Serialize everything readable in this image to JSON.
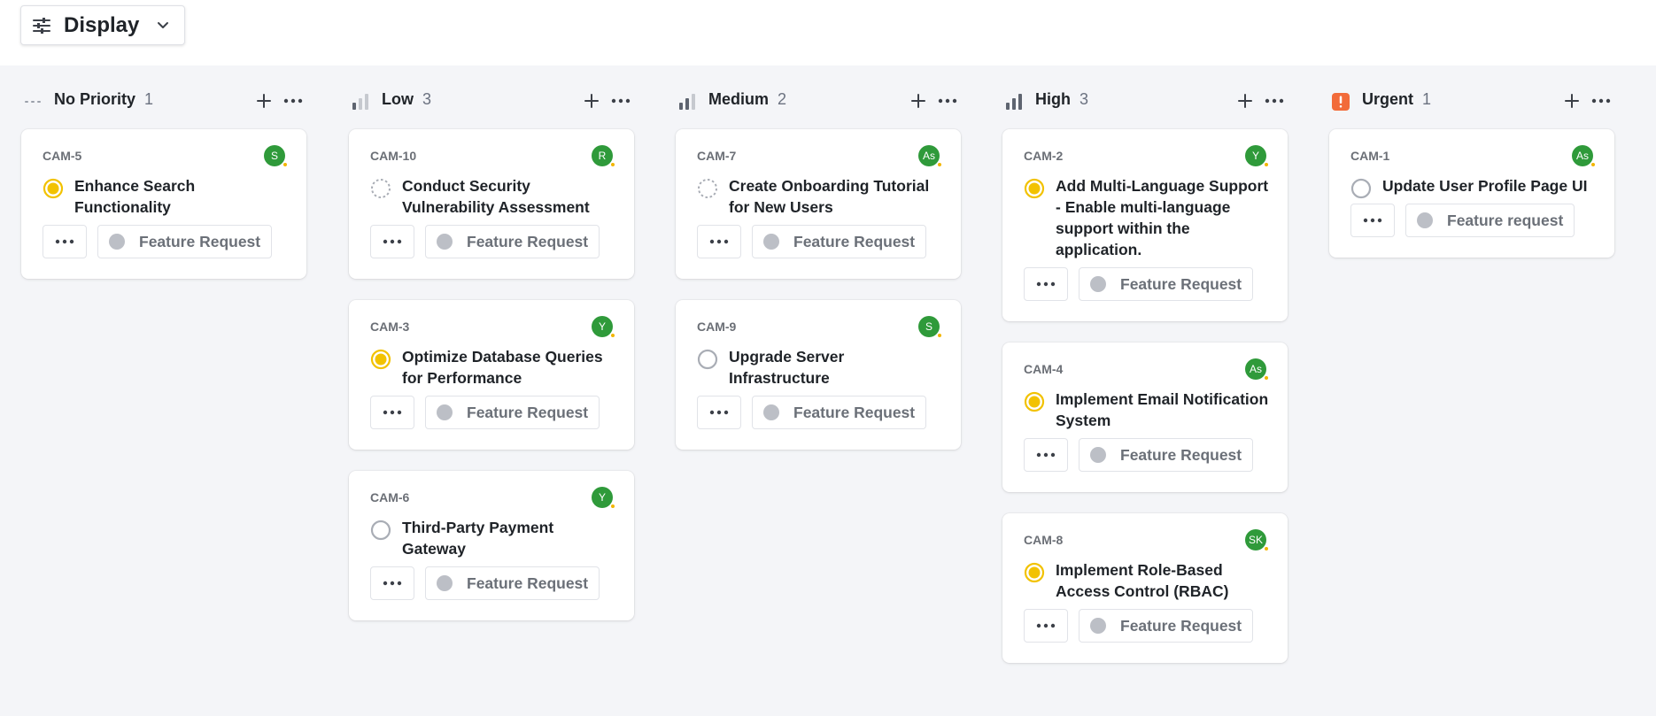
{
  "toolbar": {
    "display_label": "Display",
    "display_icon": "tune-icon",
    "chevron_icon": "chevron-down-icon"
  },
  "colors": {
    "board_bg": "#f4f5f8",
    "avatar_green": "#2f9a3a",
    "status_yellow": "#f2c200",
    "urgent_orange": "#f26b3a",
    "muted_gray": "#bcbfc6"
  },
  "columns": [
    {
      "title": "No Priority",
      "count": "1",
      "icon": "no-priority-icon",
      "cards": [
        {
          "id": "CAM-5",
          "avatar": "S",
          "status": "in-progress",
          "title": "Enhance Search Functionality",
          "label": "Feature Request"
        }
      ]
    },
    {
      "title": "Low",
      "count": "3",
      "icon": "priority-low-icon",
      "cards": [
        {
          "id": "CAM-10",
          "avatar": "R",
          "status": "backlog",
          "title": "Conduct Security Vulnerability Assessment",
          "label": "Feature Request"
        },
        {
          "id": "CAM-3",
          "avatar": "Y",
          "status": "in-progress",
          "title": "Optimize Database Queries for Performance",
          "label": "Feature Request"
        },
        {
          "id": "CAM-6",
          "avatar": "Y",
          "status": "todo",
          "title": "Third-Party Payment Gateway",
          "label": "Feature Request"
        }
      ]
    },
    {
      "title": "Medium",
      "count": "2",
      "icon": "priority-medium-icon",
      "cards": [
        {
          "id": "CAM-7",
          "avatar": "As",
          "status": "backlog",
          "title": "Create Onboarding Tutorial for New Users",
          "label": "Feature Request"
        },
        {
          "id": "CAM-9",
          "avatar": "S",
          "status": "todo",
          "title": "Upgrade Server Infrastructure",
          "label": "Feature Request"
        }
      ]
    },
    {
      "title": "High",
      "count": "3",
      "icon": "priority-high-icon",
      "cards": [
        {
          "id": "CAM-2",
          "avatar": "Y",
          "status": "in-progress",
          "title": "Add Multi-Language Support - Enable multi-language support within the application.",
          "label": "Feature Request"
        },
        {
          "id": "CAM-4",
          "avatar": "As",
          "status": "in-progress",
          "title": "Implement Email Notification System",
          "label": "Feature Request"
        },
        {
          "id": "CAM-8",
          "avatar": "SK",
          "status": "in-progress",
          "title": "Implement Role-Based Access Control (RBAC)",
          "label": "Feature Request"
        }
      ]
    },
    {
      "title": "Urgent",
      "count": "1",
      "icon": "priority-urgent-icon",
      "cards": [
        {
          "id": "CAM-1",
          "avatar": "As",
          "status": "todo",
          "title": "Update User Profile Page UI",
          "label": "Feature request"
        }
      ]
    }
  ]
}
